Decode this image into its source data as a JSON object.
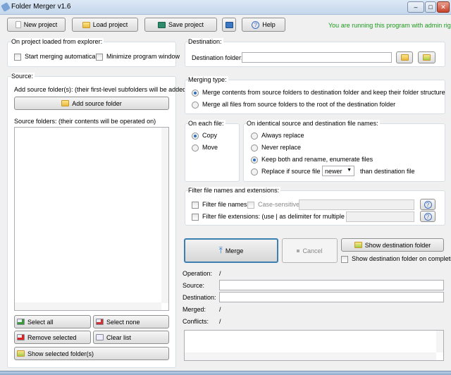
{
  "window": {
    "title": "Folder Merger v1.6",
    "minimize": "–",
    "maximize": "□",
    "close": "✕"
  },
  "toolbar": {
    "new_project": "New project",
    "load_project": "Load project",
    "save_project": "Save project",
    "help": "Help",
    "admin_notice": "You are running this program with admin rights."
  },
  "project_group": {
    "legend": "On project loaded from explorer:",
    "start_merging": "Start merging automatically",
    "minimize_window": "Minimize program window"
  },
  "destination": {
    "legend": "Destination:",
    "folder_label": "Destination folder:",
    "folder_value": ""
  },
  "source": {
    "legend": "Source:",
    "add_hint": "Add source folder(s): (their first-level subfolders will be added)",
    "add_button": "Add source folder",
    "list_label": "Source folders: (their contents will be operated on)",
    "select_all": "Select all",
    "select_none": "Select none",
    "remove_selected": "Remove selected",
    "clear_list": "Clear list",
    "show_selected": "Show selected folder(s)"
  },
  "merging_type": {
    "legend": "Merging type:",
    "option_keep_structure": "Merge contents from source folders to destination folder and keep their folder structure",
    "option_root": "Merge all files from source folders to the root of the destination folder"
  },
  "each_file": {
    "legend": "On each file:",
    "copy": "Copy",
    "move": "Move"
  },
  "identical": {
    "legend": "On identical source and destination file names:",
    "always": "Always replace",
    "never": "Never replace",
    "keep_both": "Keep both and rename, enumerate files",
    "replace_if": "Replace if source file is",
    "condition": "newer",
    "than": "than destination file"
  },
  "filter": {
    "legend": "Filter file names and extensions:",
    "names": "Filter file names:",
    "case_sensitive": "Case-sensitive",
    "extensions": "Filter file extensions: (use | as delimiter for multiple entries)"
  },
  "actions": {
    "merge": "Merge",
    "cancel": "Cancel",
    "show_destination": "Show destination folder",
    "show_on_completion": "Show destination folder on completion"
  },
  "status": {
    "operation_label": "Operation:",
    "operation_value": "/",
    "source_label": "Source:",
    "destination_label": "Destination:",
    "merged_label": "Merged:",
    "merged_value": "/",
    "conflicts_label": "Conflicts:",
    "conflicts_value": "/"
  },
  "colors": {
    "admin_text": "#1e9a1e",
    "merge_border": "#3c7fb1"
  }
}
